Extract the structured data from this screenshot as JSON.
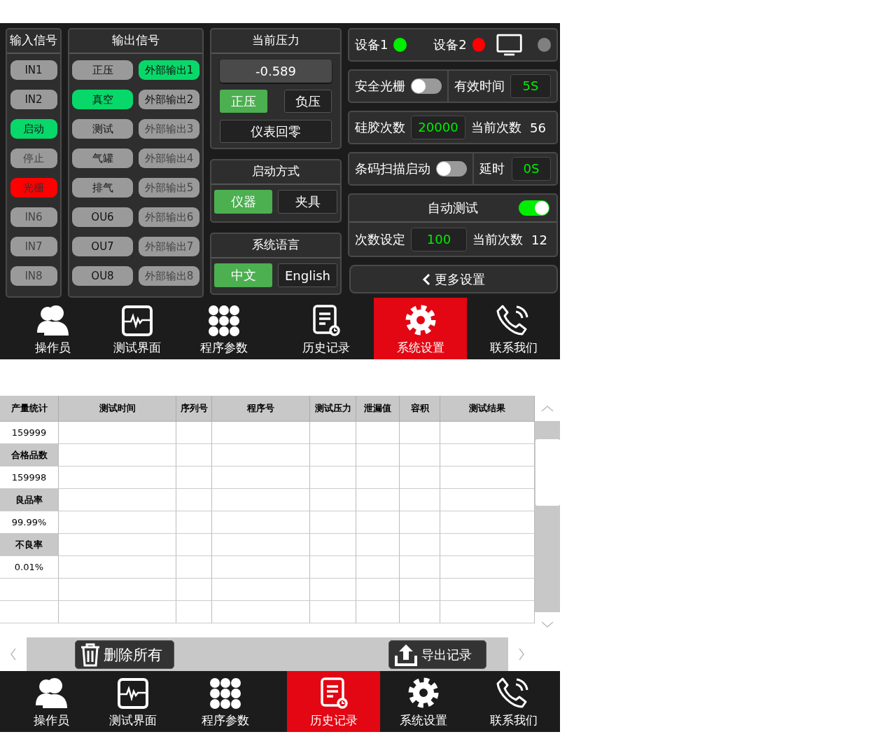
{
  "settings_screen": {
    "inputs": {
      "title": "输入信号",
      "items": [
        {
          "label": "IN1",
          "on": false,
          "alarm": false,
          "disabled": false
        },
        {
          "label": "IN2",
          "on": false,
          "alarm": false,
          "disabled": false
        },
        {
          "label": "启动",
          "on": true,
          "alarm": false,
          "disabled": false
        },
        {
          "label": "停止",
          "on": false,
          "alarm": false,
          "disabled": true
        },
        {
          "label": "光栅",
          "on": false,
          "alarm": true,
          "disabled": false
        },
        {
          "label": "IN6",
          "on": false,
          "alarm": false,
          "disabled": true
        },
        {
          "label": "IN7",
          "on": false,
          "alarm": false,
          "disabled": true
        },
        {
          "label": "IN8",
          "on": false,
          "alarm": false,
          "disabled": true
        }
      ]
    },
    "outputs": {
      "title": "输出信号",
      "items": [
        {
          "label": "正压",
          "on": false,
          "disabled": false
        },
        {
          "label": "外部输出1",
          "on": true,
          "disabled": false
        },
        {
          "label": "真空",
          "on": true,
          "disabled": false
        },
        {
          "label": "外部输出2",
          "on": false,
          "disabled": false
        },
        {
          "label": "测试",
          "on": false,
          "disabled": false
        },
        {
          "label": "外部输出3",
          "on": false,
          "disabled": true
        },
        {
          "label": "气罐",
          "on": false,
          "disabled": false
        },
        {
          "label": "外部输出4",
          "on": false,
          "disabled": true
        },
        {
          "label": "排气",
          "on": false,
          "disabled": false
        },
        {
          "label": "外部输出5",
          "on": false,
          "disabled": true
        },
        {
          "label": "OU6",
          "on": false,
          "disabled": false
        },
        {
          "label": "外部输出6",
          "on": false,
          "disabled": true
        },
        {
          "label": "OU7",
          "on": false,
          "disabled": false
        },
        {
          "label": "外部输出7",
          "on": false,
          "disabled": true
        },
        {
          "label": "OU8",
          "on": false,
          "disabled": false
        },
        {
          "label": "外部输出8",
          "on": false,
          "disabled": true
        }
      ]
    },
    "pressure": {
      "title": "当前压力",
      "value": "-0.589",
      "modes": [
        {
          "label": "正压",
          "selected": true
        },
        {
          "label": "负压",
          "selected": false
        }
      ],
      "zero_button": "仪表回零"
    },
    "start_mode": {
      "title": "启动方式",
      "options": [
        {
          "label": "仪器",
          "selected": true
        },
        {
          "label": "夹具",
          "selected": false
        }
      ]
    },
    "language": {
      "title": "系统语言",
      "options": [
        {
          "label": "中文",
          "selected": true
        },
        {
          "label": "English",
          "selected": false
        }
      ]
    },
    "devices": [
      {
        "label": "设备1",
        "color": "#00ee00"
      },
      {
        "label": "设备2",
        "color": "#ff0000"
      }
    ],
    "screen_status": {
      "color": "#808080"
    },
    "light_curtain": {
      "label": "安全光栅",
      "on": false,
      "time_label": "有效时间",
      "time_value": "5S"
    },
    "silicone": {
      "label": "硅胶次数",
      "value": "20000",
      "current_label": "当前次数",
      "current_value": "56"
    },
    "barcode": {
      "label": "条码扫描启动",
      "on": false,
      "delay_label": "延时",
      "delay_value": "0S"
    },
    "auto_test": {
      "title": "自动测试",
      "on": true,
      "count_label": "次数设定",
      "count_value": "100",
      "current_label": "当前次数",
      "current_value": "12"
    },
    "more_button": "更多设置",
    "nav": [
      {
        "label": "操作员",
        "selected": false
      },
      {
        "label": "测试界面",
        "selected": false
      },
      {
        "label": "程序参数",
        "selected": false
      },
      {
        "label": "历史记录",
        "selected": false
      },
      {
        "label": "系统设置",
        "selected": true
      },
      {
        "label": "联系我们",
        "selected": false
      }
    ]
  },
  "history_screen": {
    "columns": [
      "产量统计",
      "测试时间",
      "序列号",
      "程序号",
      "测试压力",
      "泄漏值",
      "容积",
      "测试结果"
    ],
    "stats": [
      {
        "text": "159999",
        "kind": "value"
      },
      {
        "text": "合格品数",
        "kind": "label"
      },
      {
        "text": "159998",
        "kind": "value"
      },
      {
        "text": "良品率",
        "kind": "label"
      },
      {
        "text": "99.99%",
        "kind": "value"
      },
      {
        "text": "不良率",
        "kind": "label"
      },
      {
        "text": "0.01%",
        "kind": "value"
      }
    ],
    "delete_button": "删除所有",
    "export_button": "导出记录",
    "nav": [
      {
        "label": "操作员",
        "selected": false
      },
      {
        "label": "测试界面",
        "selected": false
      },
      {
        "label": "程序参数",
        "selected": false
      },
      {
        "label": "历史记录",
        "selected": true
      },
      {
        "label": "系统设置",
        "selected": false
      },
      {
        "label": "联系我们",
        "selected": false
      }
    ]
  }
}
